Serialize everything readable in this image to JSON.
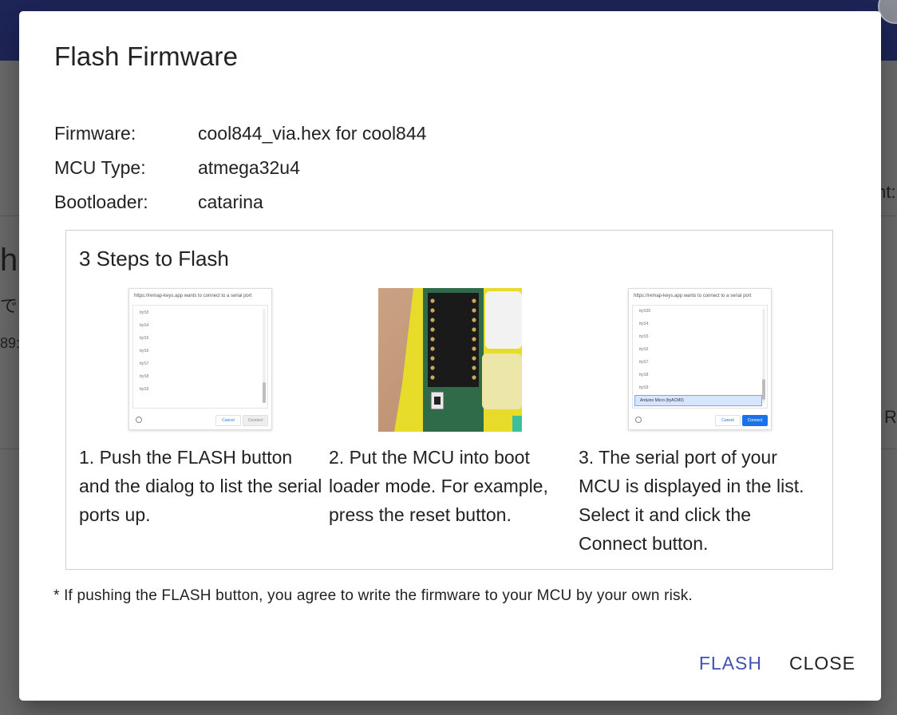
{
  "background": {
    "partial_texts": [
      "h",
      "で",
      "89:",
      "nt:",
      "RC"
    ]
  },
  "dialog": {
    "title": "Flash Firmware",
    "info": [
      {
        "label": "Firmware:",
        "value": "cool844_via.hex for cool844"
      },
      {
        "label": "MCU Type:",
        "value": "atmega32u4"
      },
      {
        "label": "Bootloader:",
        "value": "catarina"
      }
    ],
    "steps_title": "3 Steps to Flash",
    "steps": [
      {
        "caption": "1. Push the FLASH button and the dialog to list the serial ports up."
      },
      {
        "caption": "2. Put the MCU into boot loader mode. For example, press the reset button."
      },
      {
        "caption": "3. The serial port of your MCU is displayed in the list. Select it and click the Connect button."
      }
    ],
    "serial_dialog": {
      "header": "https://remap-keys.app wants to connect to a serial port",
      "ports_step1": [
        "ttyS5",
        "ttyS4",
        "ttyS5",
        "ttyS6",
        "ttyS7",
        "ttyS8",
        "ttyS9"
      ],
      "ports_step3": [
        "ttyS35",
        "ttyS4",
        "ttyS5",
        "ttyS6",
        "ttyS7",
        "ttyS8",
        "ttyS9"
      ],
      "selected_port": "Arduino Micro   (ttyACM0)",
      "cancel_label": "Cancel",
      "connect_label": "Connect"
    },
    "note": "* If pushing the FLASH button, you agree to write the firmware to your MCU by your own risk.",
    "flash_label": "FLASH",
    "close_label": "CLOSE"
  },
  "colors": {
    "primary": "#3f51b5",
    "header_bg": "#1e2658",
    "selected_port_bg": "#d6e6ff",
    "connect_blue": "#1a73e8"
  }
}
